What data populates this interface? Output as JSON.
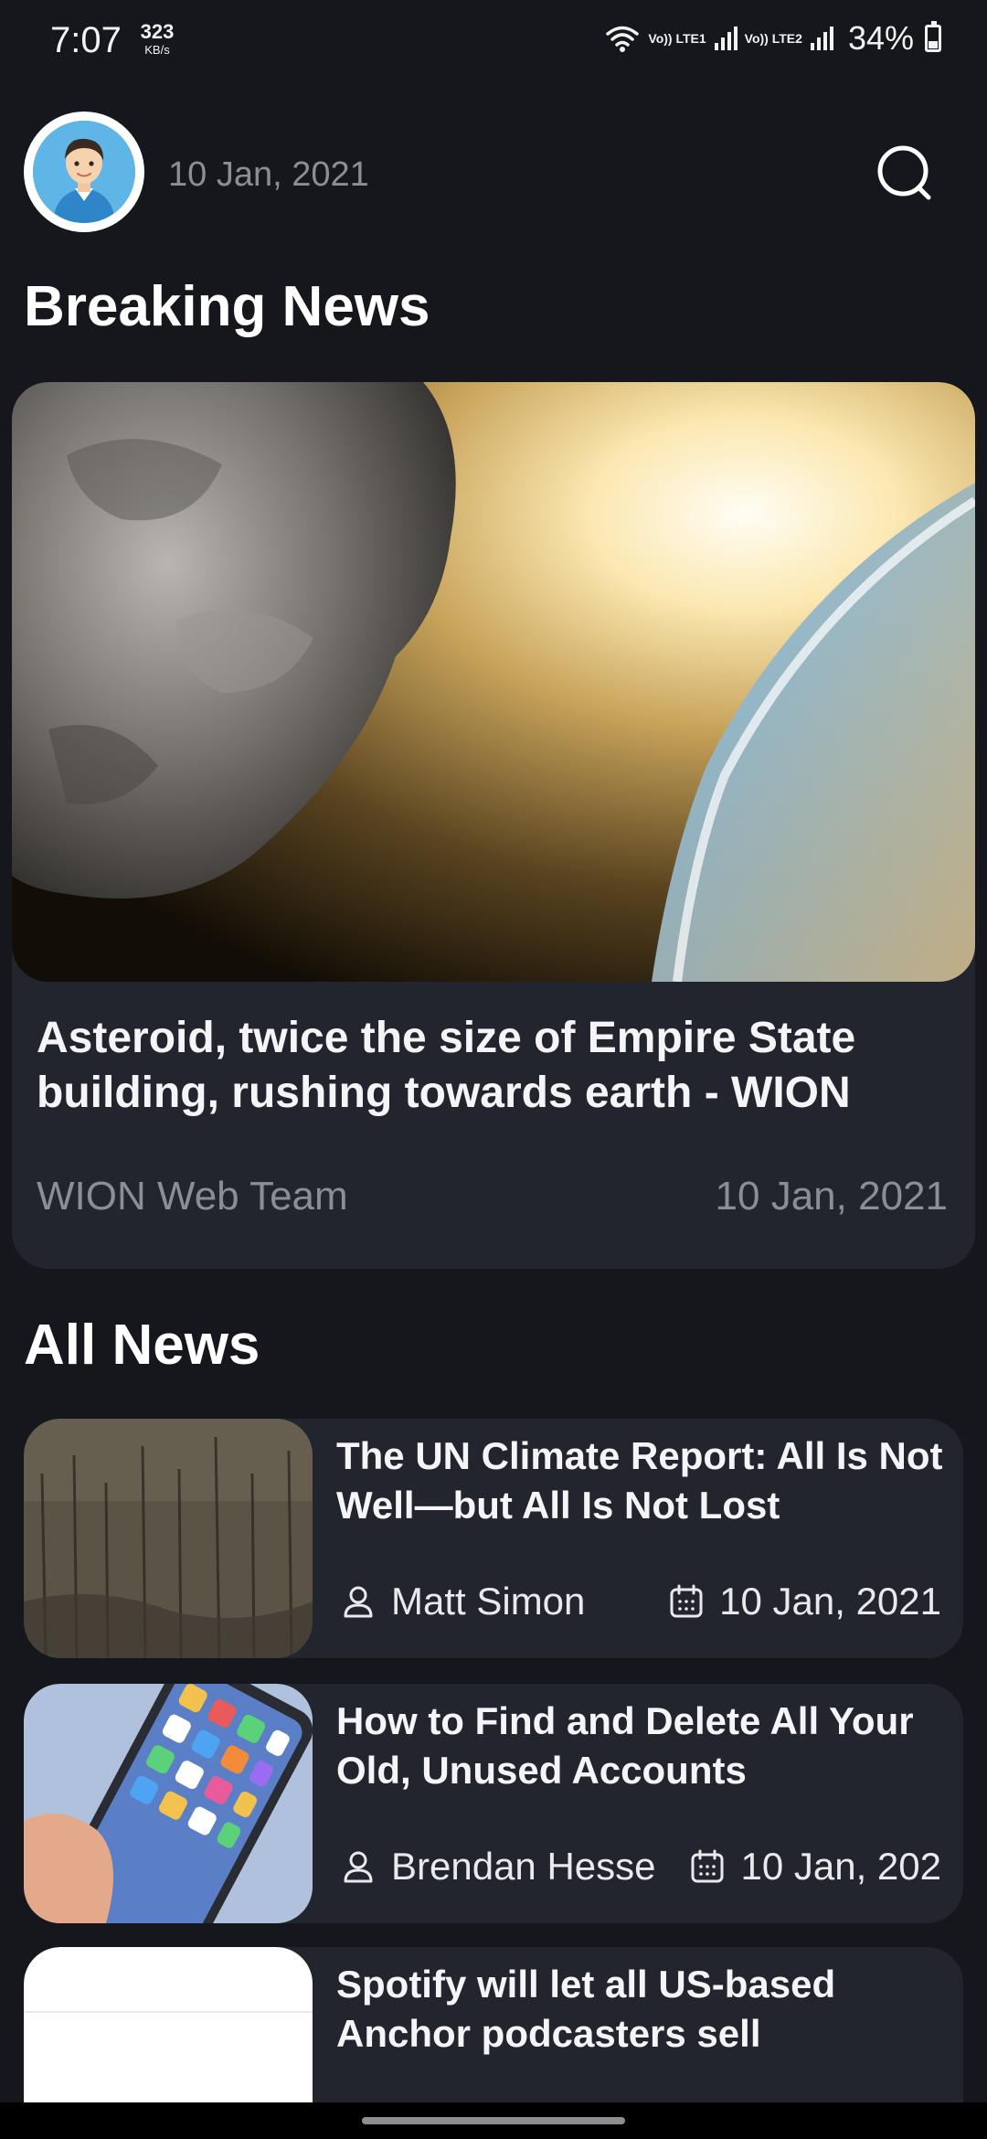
{
  "status_bar": {
    "time": "7:07",
    "speed_value": "323",
    "speed_unit": "KB/s",
    "sim1": "Vo)) LTE1",
    "sim2": "Vo)) LTE2",
    "battery": "34%",
    "battery_level": 0.34,
    "icons": [
      "wifi-icon",
      "signal-icon",
      "battery-icon"
    ]
  },
  "header": {
    "date": "10 Jan, 2021",
    "avatar_icon": "user-avatar",
    "search_icon": "search-icon"
  },
  "breaking": {
    "section_title": "Breaking News",
    "title": "Asteroid, twice the size of Empire State building, rushing towards earth - WION",
    "author": "WION Web Team",
    "date": "10 Jan, 2021",
    "image": "asteroid-approaching-earth"
  },
  "all_news": {
    "section_title": "All News",
    "items": [
      {
        "title": "The UN Climate Report: All Is Not Well—but All Is Not Lost",
        "author": "Matt Simon",
        "date": "10 Jan, 2021",
        "image": "burned-forest"
      },
      {
        "title": "How to Find and Delete All Your Old, Unused Accounts",
        "author": "Brendan Hesse",
        "date": "10 Jan, 202",
        "image": "smartphone-in-hand"
      },
      {
        "title": "Spotify will let all US-based Anchor podcasters sell",
        "author": "",
        "date": "",
        "image": "blank"
      }
    ]
  },
  "colors": {
    "background": "#16171c",
    "card": "#22242e",
    "muted_text": "#8b8d97",
    "text": "#ffffff"
  }
}
